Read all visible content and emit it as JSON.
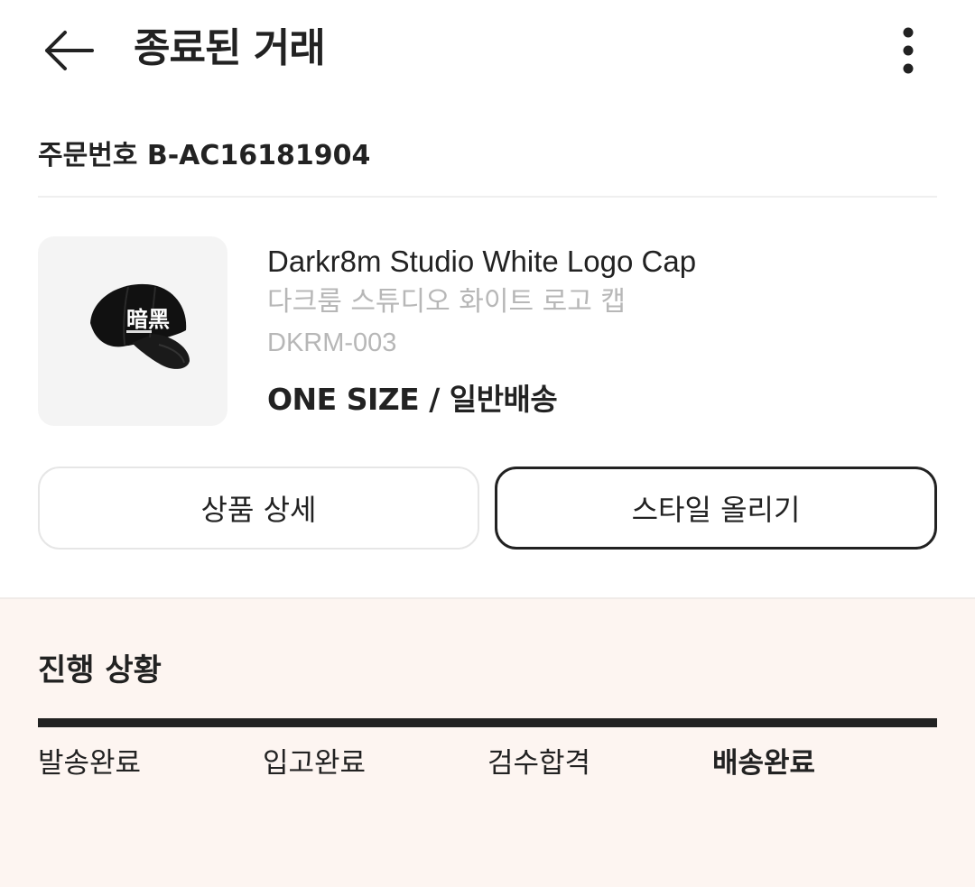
{
  "header": {
    "title": "종료된 거래",
    "back_icon": "arrow-left-icon",
    "more_icon": "more-vertical-icon"
  },
  "order": {
    "number_text": "주문번호 B-AC16181904"
  },
  "product": {
    "image_icon": "cap-image",
    "cap_logo_text": "暗黑",
    "name_en": "Darkr8m Studio White Logo Cap",
    "name_ko": "다크룸 스튜디오 화이트 로고 캡",
    "code": "DKRM-003",
    "option": "ONE SIZE / 일반배송"
  },
  "buttons": {
    "detail_label": "상품 상세",
    "style_label": "스타일 올리기"
  },
  "progress": {
    "title": "진행 상황",
    "fill_percent": 100,
    "steps": [
      {
        "label": "발송완료",
        "active": false
      },
      {
        "label": "입고완료",
        "active": false
      },
      {
        "label": "검수합격",
        "active": false
      },
      {
        "label": "배송완료",
        "active": true
      }
    ]
  },
  "colors": {
    "text": "#222222",
    "muted": "#b7b7b7",
    "progress_bg": "#fdf5f1",
    "thumb_bg": "#f4f4f4"
  }
}
